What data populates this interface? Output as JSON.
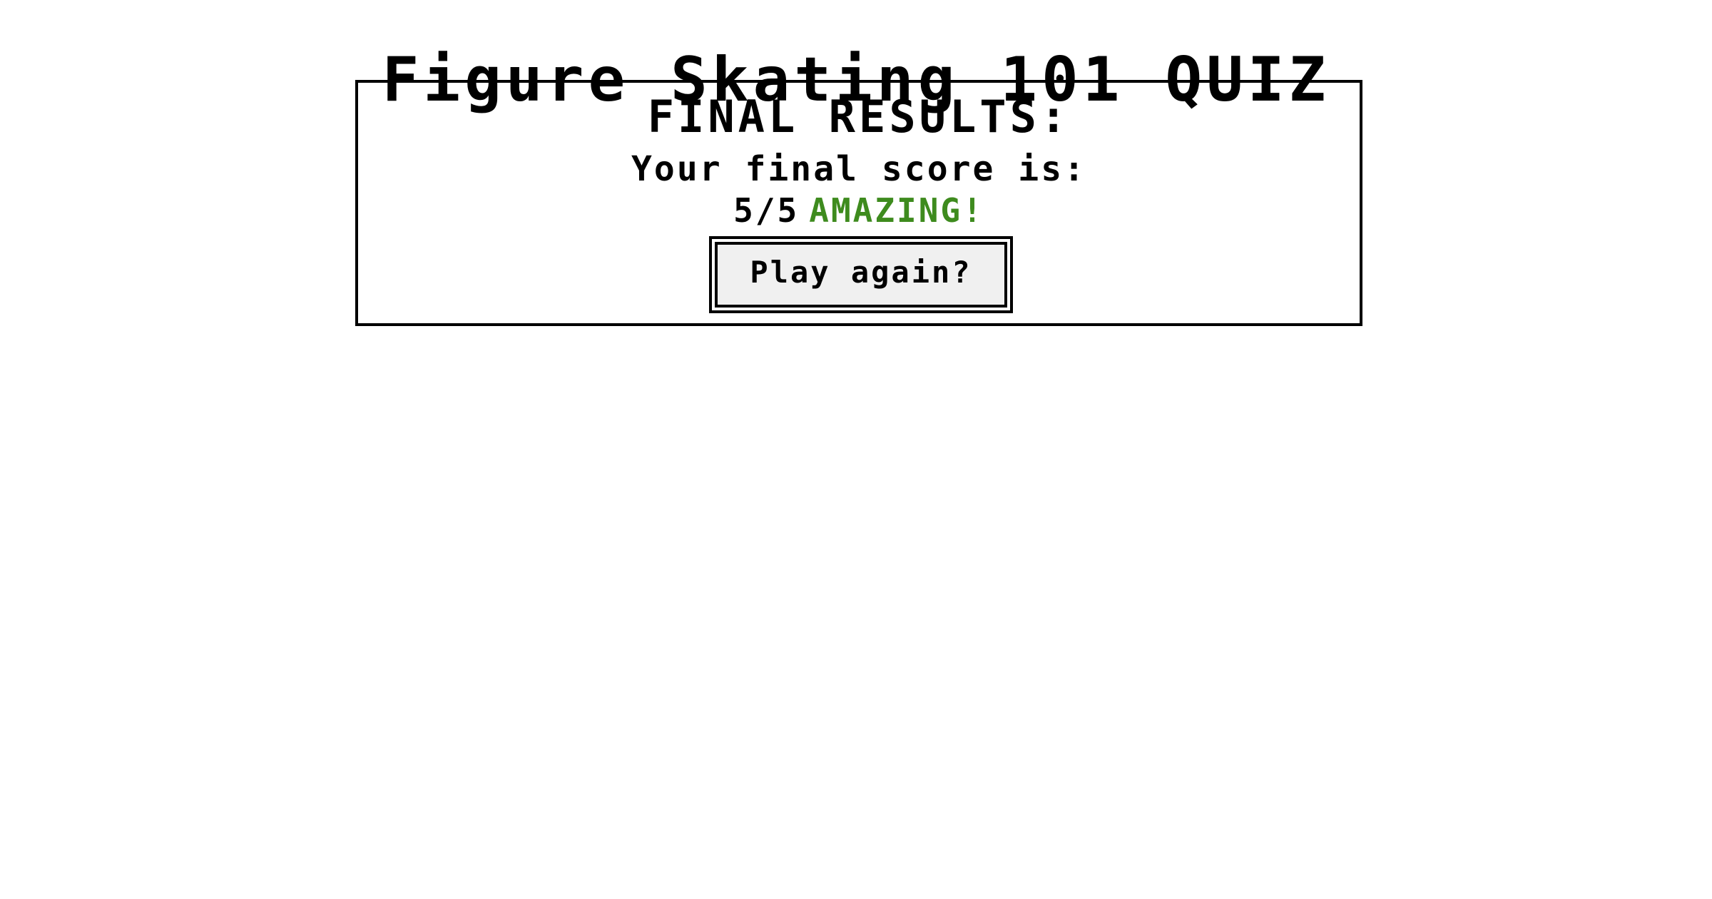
{
  "title": "Figure Skating 101 QUIZ",
  "results": {
    "heading": "FINAL RESULTS:",
    "score_label": "Your final score is:",
    "score": "5/5",
    "rating": "AMAZING!",
    "rating_color": "#3e8b1e",
    "play_again_label": "Play again?"
  }
}
